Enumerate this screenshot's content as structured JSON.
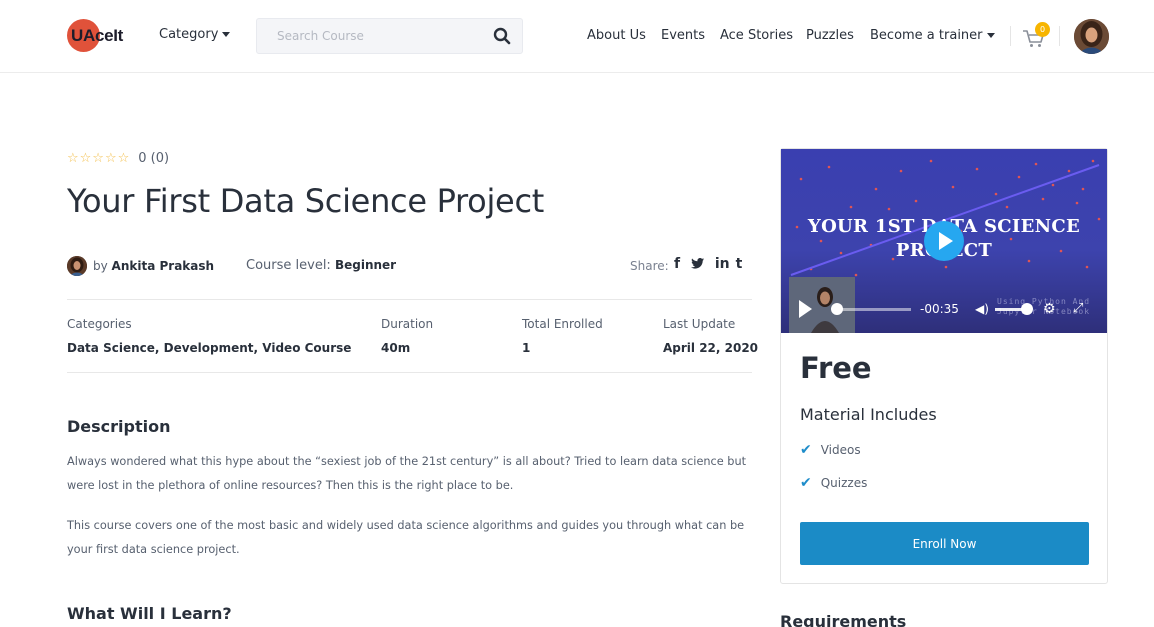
{
  "header": {
    "logo_text": "UAceIt",
    "category_label": "Category",
    "search_placeholder": "Search Course",
    "nav": [
      "About Us",
      "Events",
      "Ace Stories",
      "Puzzles"
    ],
    "trainer_label": "Become a trainer",
    "cart_count": "0"
  },
  "course": {
    "rating_text": "0 (0)",
    "title": "Your First Data Science Project",
    "by_prefix": "by",
    "author": "Ankita Prakash",
    "level_label": "Course level:",
    "level_value": "Beginner",
    "share_label": "Share:",
    "share_icons": [
      "f",
      "t-bird",
      "in",
      "t"
    ],
    "meta": [
      {
        "label": "Categories",
        "value": "Data Science, Development, Video Course"
      },
      {
        "label": "Duration",
        "value": "40m"
      },
      {
        "label": "Total Enrolled",
        "value": "1"
      },
      {
        "label": "Last Update",
        "value": "April 22, 2020"
      }
    ]
  },
  "description": {
    "heading": "Description",
    "p1": "Always wondered what this hype about the “sexiest job of the 21st century” is all about? Tried to learn data science but were lost in the plethora of online resources? Then this is the right place to be.",
    "p2": "This course covers one of the most basic and widely used data science algorithms and guides you through what can be your first data science project."
  },
  "learn": {
    "heading": "What Will I Learn?"
  },
  "sidebar": {
    "video_title_line1": "YOUR 1ST DATA SCIENCE",
    "video_title_line2": "PROJECT",
    "video_time": "-00:35",
    "video_caption_line1": "Using Python And",
    "video_caption_line2": "Jupyter Notebook",
    "video_progress": 0.05,
    "price": "Free",
    "material_heading": "Material Includes",
    "materials": [
      "Videos",
      "Quizzes"
    ],
    "enroll_label": "Enroll Now",
    "requirements_heading": "Requirements"
  },
  "colors": {
    "accent": "#1b8bc6",
    "star": "#f4c150",
    "badge": "#f7b500",
    "video_bg": "#3a3fb0",
    "play": "#26a7f0"
  }
}
